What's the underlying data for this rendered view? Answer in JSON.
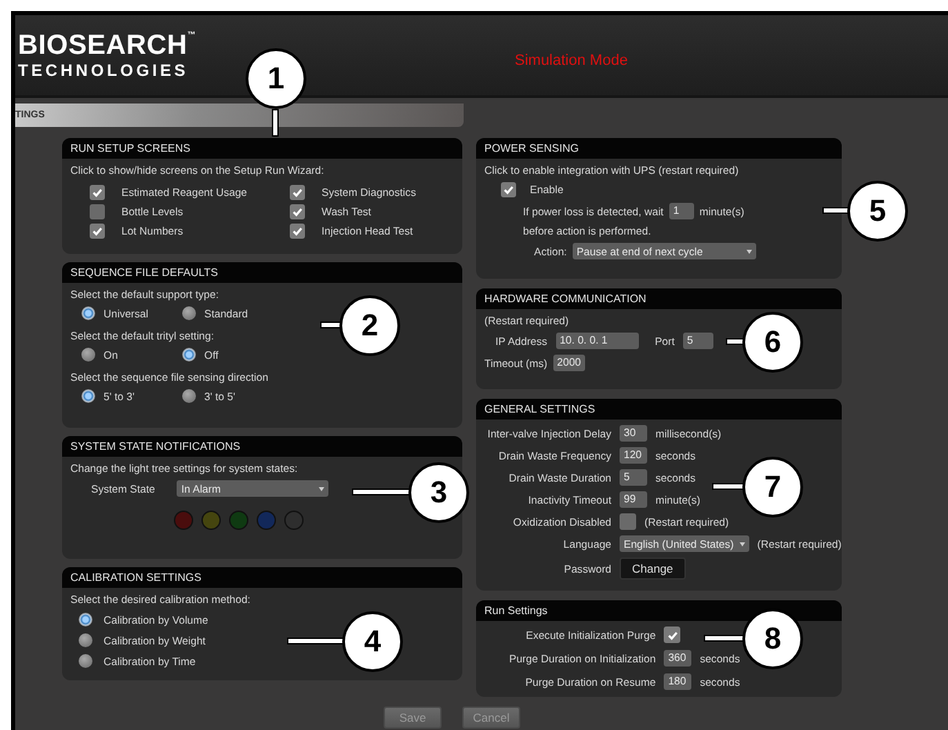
{
  "header": {
    "logo_top": "BIOSEARCH",
    "trademark": "™",
    "logo_bottom": "TECHNOLOGIES",
    "mode": "Simulation Mode"
  },
  "tab": {
    "label": "TINGS"
  },
  "run_setup_screens": {
    "title": "RUN SETUP SCREENS",
    "instruction": "Click to show/hide screens on the Setup Run Wizard:",
    "options": [
      {
        "label": "Estimated Reagent Usage",
        "checked": true
      },
      {
        "label": "Bottle Levels",
        "checked": false
      },
      {
        "label": "Lot Numbers",
        "checked": true
      },
      {
        "label": "System Diagnostics",
        "checked": true
      },
      {
        "label": "Wash Test",
        "checked": true
      },
      {
        "label": "Injection Head Test",
        "checked": true
      }
    ]
  },
  "sequence_file_defaults": {
    "title": "SEQUENCE FILE DEFAULTS",
    "groups": [
      {
        "prompt": "Select the default support type:",
        "options": [
          {
            "label": "Universal",
            "selected": true
          },
          {
            "label": "Standard",
            "selected": false
          }
        ]
      },
      {
        "prompt": "Select the default trityl setting:",
        "options": [
          {
            "label": "On",
            "selected": false
          },
          {
            "label": "Off",
            "selected": true
          }
        ]
      },
      {
        "prompt": "Select the sequence file sensing direction",
        "options": [
          {
            "label": "5' to 3'",
            "selected": true
          },
          {
            "label": "3' to 5'",
            "selected": false
          }
        ]
      }
    ]
  },
  "system_state_notifications": {
    "title": "SYSTEM STATE NOTIFICATIONS",
    "instruction": "Change the light tree settings for system states:",
    "state_label": "System State",
    "state_value": "In Alarm",
    "lights": [
      {
        "color": "#4a0d0d"
      },
      {
        "color": "#45450f"
      },
      {
        "color": "#0f3a12"
      },
      {
        "color": "#12285a"
      },
      {
        "color": "#2e2e2e"
      }
    ]
  },
  "calibration_settings": {
    "title": "CALIBRATION SETTINGS",
    "instruction": "Select the desired calibration method:",
    "options": [
      {
        "label": "Calibration by Volume",
        "selected": true
      },
      {
        "label": "Calibration by Weight",
        "selected": false
      },
      {
        "label": "Calibration by Time",
        "selected": false
      }
    ]
  },
  "power_sensing": {
    "title": "POWER SENSING",
    "instruction": "Click to enable integration with UPS  (restart required)",
    "enable": {
      "label": "Enable",
      "checked": true
    },
    "wait_prefix": "If power loss is detected, wait",
    "wait_value": "1",
    "wait_suffix": "minute(s)",
    "wait_line2": "before action is performed.",
    "action_label": "Action:",
    "action_value": "Pause at end of next cycle"
  },
  "hardware_communication": {
    "title": "HARDWARE COMMUNICATION",
    "note": "(Restart required)",
    "ip_label": "IP Address",
    "ip_value": "10.  0.  0.  1",
    "port_label": "Port",
    "port_value": "5",
    "timeout_label": "Timeout (ms)",
    "timeout_value": "2000"
  },
  "general_settings": {
    "title": "GENERAL SETTINGS",
    "rows": [
      {
        "kind": "field",
        "label": "Inter-valve Injection Delay",
        "value": "30",
        "unit": "millisecond(s)"
      },
      {
        "kind": "field",
        "label": "Drain Waste Frequency",
        "value": "120",
        "unit": "seconds"
      },
      {
        "kind": "field",
        "label": "Drain Waste Duration",
        "value": "5",
        "unit": "seconds"
      },
      {
        "kind": "field",
        "label": "Inactivity Timeout",
        "value": "99",
        "unit": "minute(s)"
      },
      {
        "kind": "checkbox",
        "label": "Oxidization Disabled",
        "checked": false,
        "note": "(Restart required)"
      },
      {
        "kind": "select",
        "label": "Language",
        "value": "English (United States)",
        "note": "(Restart required)"
      },
      {
        "kind": "button",
        "label": "Password",
        "button": "Change"
      }
    ]
  },
  "run_settings": {
    "title": "Run Settings",
    "rows": [
      {
        "kind": "checkbox",
        "label": "Execute Initialization Purge",
        "checked": true,
        "children": [
          {
            "kind": "field",
            "label": "Purge Duration on Initialization",
            "value": "360",
            "unit": "seconds"
          }
        ]
      },
      {
        "kind": "field",
        "label": "Purge Duration on Resume",
        "value": "180",
        "unit": "seconds"
      }
    ]
  },
  "buttons": [
    {
      "label": "Save",
      "disabled": true
    },
    {
      "label": "Cancel",
      "disabled": true
    }
  ],
  "callouts": [
    "1",
    "2",
    "3",
    "4",
    "5",
    "6",
    "7",
    "8"
  ]
}
